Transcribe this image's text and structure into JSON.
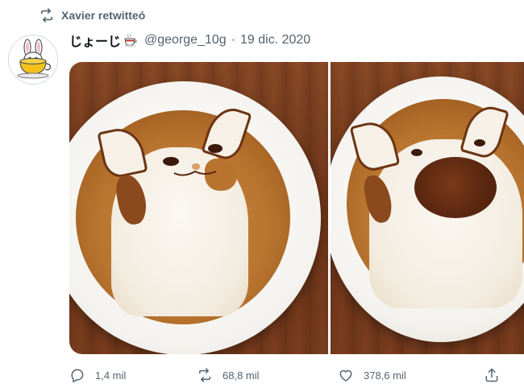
{
  "retweet_context": {
    "label": "Xavier retwitteó",
    "icon": "retweet-icon"
  },
  "author": {
    "display_name": "じょーじ",
    "name_emoji": "coffee-cup-emoji",
    "handle": "@george_10g",
    "separator": "·",
    "date": "19 dic. 2020",
    "avatar": "bunny-in-teacup-avatar"
  },
  "media": {
    "photos": [
      {
        "depicts": "latte-art-cat-closed-mouth"
      },
      {
        "depicts": "latte-art-cat-open-mouth"
      }
    ]
  },
  "actions": {
    "reply": {
      "count": "1,4 mil",
      "icon": "reply-icon"
    },
    "retweet": {
      "count": "68,8 mil",
      "icon": "retweet-icon"
    },
    "like": {
      "count": "378,6 mil",
      "icon": "heart-icon"
    },
    "share": {
      "icon": "share-icon"
    }
  },
  "colors": {
    "text_primary": "#0f1419",
    "text_secondary": "#536471",
    "background": "#ffffff",
    "avatar_cup": "#f2c21b"
  }
}
